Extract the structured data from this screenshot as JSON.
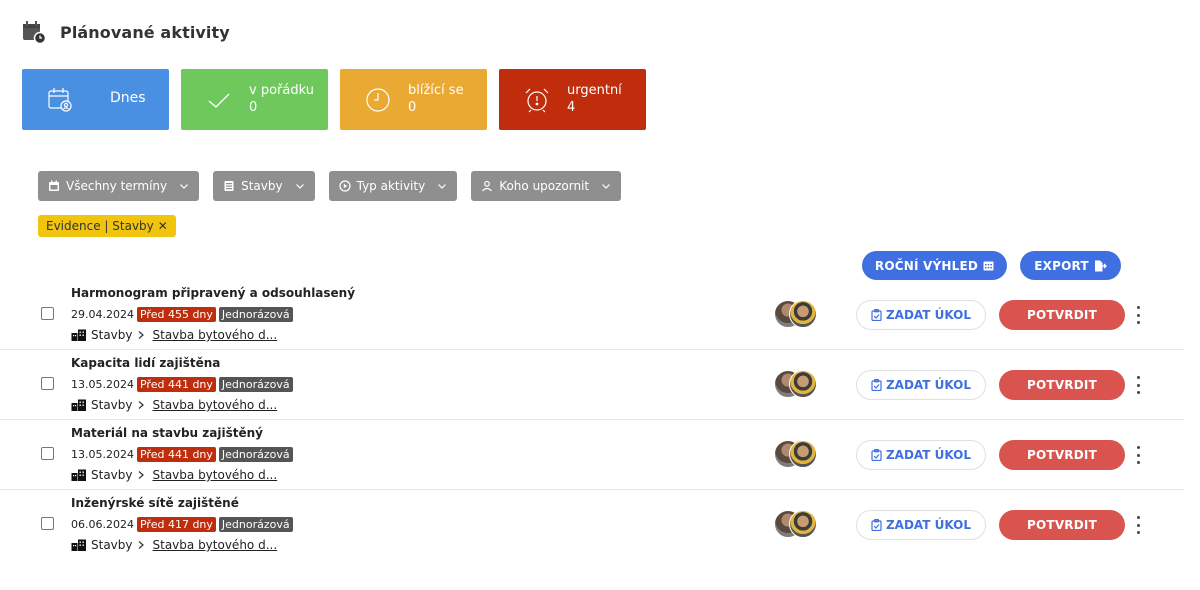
{
  "header": {
    "title": "Plánované aktivity",
    "icon": "calendar-clock-icon"
  },
  "cards": [
    {
      "key": "today",
      "label": "Dnes",
      "count": "",
      "icon": "calendar-user-icon",
      "color": "#4a90e2"
    },
    {
      "key": "ok",
      "label": "v pořádku",
      "count": "0",
      "icon": "check-icon",
      "color": "#6fc85c"
    },
    {
      "key": "soon",
      "label": "blížící se",
      "count": "0",
      "icon": "clock-icon",
      "color": "#eaa933"
    },
    {
      "key": "urgent",
      "label": "urgentní",
      "count": "4",
      "icon": "alarm-clock-icon",
      "color": "#c02d0c"
    }
  ],
  "filters": [
    {
      "label": "Všechny termíny",
      "icon": "calendar-icon"
    },
    {
      "label": "Stavby",
      "icon": "building-icon"
    },
    {
      "label": "Typ aktivity",
      "icon": "play-circle-icon"
    },
    {
      "label": "Koho upozornit",
      "icon": "user-icon"
    }
  ],
  "active_filter": {
    "label": "Evidence | Stavby",
    "remove": "✕"
  },
  "actions": {
    "rocni": "ROČNÍ VÝHLED",
    "export": "EXPORT"
  },
  "rows": [
    {
      "title": "Harmonogram připravený a odsouhlasený",
      "date": "29.04.2024",
      "ago": "Před 455 dny",
      "type": "Jednorázová",
      "path_root": "Stavby",
      "path_link": "Stavba bytového d..."
    },
    {
      "title": "Kapacita lidí zajištěna",
      "date": "13.05.2024",
      "ago": "Před 441 dny",
      "type": "Jednorázová",
      "path_root": "Stavby",
      "path_link": "Stavba bytového d..."
    },
    {
      "title": "Materiál na stavbu zajištěný",
      "date": "13.05.2024",
      "ago": "Před 441 dny",
      "type": "Jednorázová",
      "path_root": "Stavby",
      "path_link": "Stavba bytového d..."
    },
    {
      "title": "Inženýrské sítě zajištěné",
      "date": "06.06.2024",
      "ago": "Před 417 dny",
      "type": "Jednorázová",
      "path_root": "Stavby",
      "path_link": "Stavba bytového d..."
    }
  ],
  "row_actions": {
    "zadat": "ZADAT ÚKOL",
    "potvrdit": "POTVRDIT"
  }
}
